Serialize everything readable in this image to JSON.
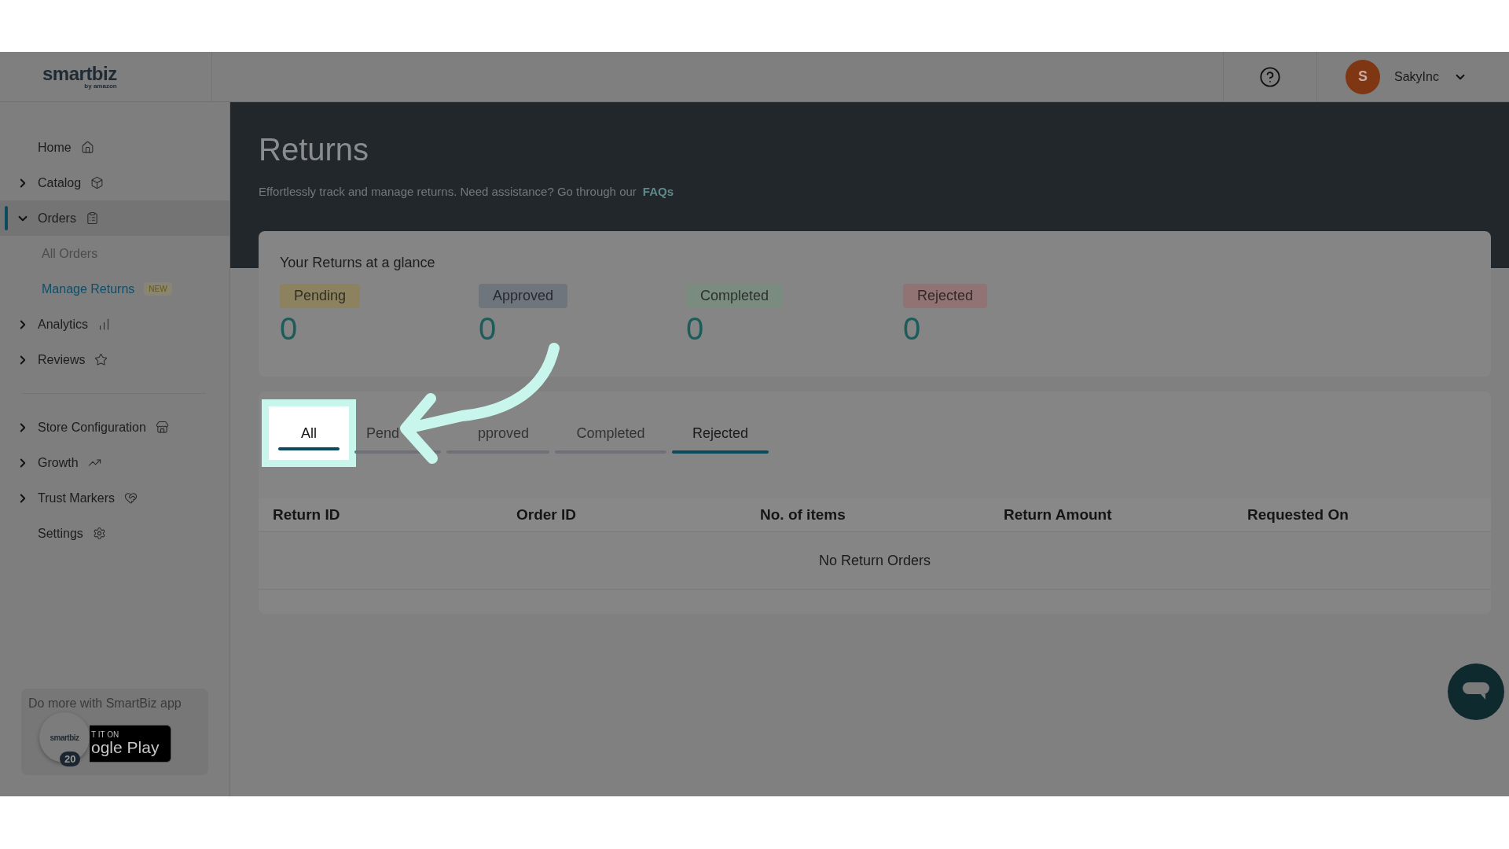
{
  "header": {
    "logo": "smartbiz",
    "logo_sub": "by amazon",
    "user": {
      "initial": "S",
      "name": "SakyInc"
    }
  },
  "sidebar": {
    "items": [
      {
        "label": "Home",
        "kind": "link"
      },
      {
        "label": "Catalog",
        "kind": "group",
        "expanded": false
      },
      {
        "label": "Orders",
        "kind": "group",
        "expanded": true,
        "selected": true,
        "children": [
          {
            "label": "All Orders",
            "selected": false
          },
          {
            "label": "Manage Returns",
            "selected": true,
            "badge": "NEW"
          }
        ]
      },
      {
        "label": "Analytics",
        "kind": "group",
        "expanded": false
      },
      {
        "label": "Reviews",
        "kind": "group",
        "expanded": false
      },
      {
        "kind": "divider"
      },
      {
        "label": "Store Configuration",
        "kind": "group",
        "expanded": false
      },
      {
        "label": "Growth",
        "kind": "group",
        "expanded": false
      },
      {
        "label": "Trust Markers",
        "kind": "group",
        "expanded": false
      },
      {
        "label": "Settings",
        "kind": "link"
      }
    ],
    "promo": {
      "text": "Do more with SmartBiz app",
      "badge_top": "T IT ON",
      "badge_main": "ogle Play",
      "circle_logo": "smartbiz",
      "count": "20"
    }
  },
  "page": {
    "title": "Returns",
    "subtitle": "Effortlessly track and manage returns. Need assistance? Go through our",
    "link": "FAQs"
  },
  "summary": {
    "title": "Your Returns at a glance",
    "stats": [
      {
        "label": "Pending",
        "value": "0",
        "color": "#8c8260"
      },
      {
        "label": "Approved",
        "value": "0",
        "color": "#6f757d"
      },
      {
        "label": "Completed",
        "value": "0",
        "color": "#7a8b7f"
      },
      {
        "label": "Rejected",
        "value": "0",
        "color": "#917373"
      }
    ]
  },
  "tabs": [
    {
      "label": "All",
      "selected": true,
      "focused": false
    },
    {
      "label": "Pend",
      "selected": false,
      "focused": false
    },
    {
      "label": "pproved",
      "selected": false,
      "focused": false
    },
    {
      "label": "Completed",
      "selected": false,
      "focused": false
    },
    {
      "label": "Rejected",
      "selected": false,
      "focused": true
    }
  ],
  "table": {
    "columns": [
      "Return ID",
      "Order ID",
      "No. of items",
      "Return Amount",
      "Requested On"
    ],
    "empty": "No Return Orders"
  }
}
